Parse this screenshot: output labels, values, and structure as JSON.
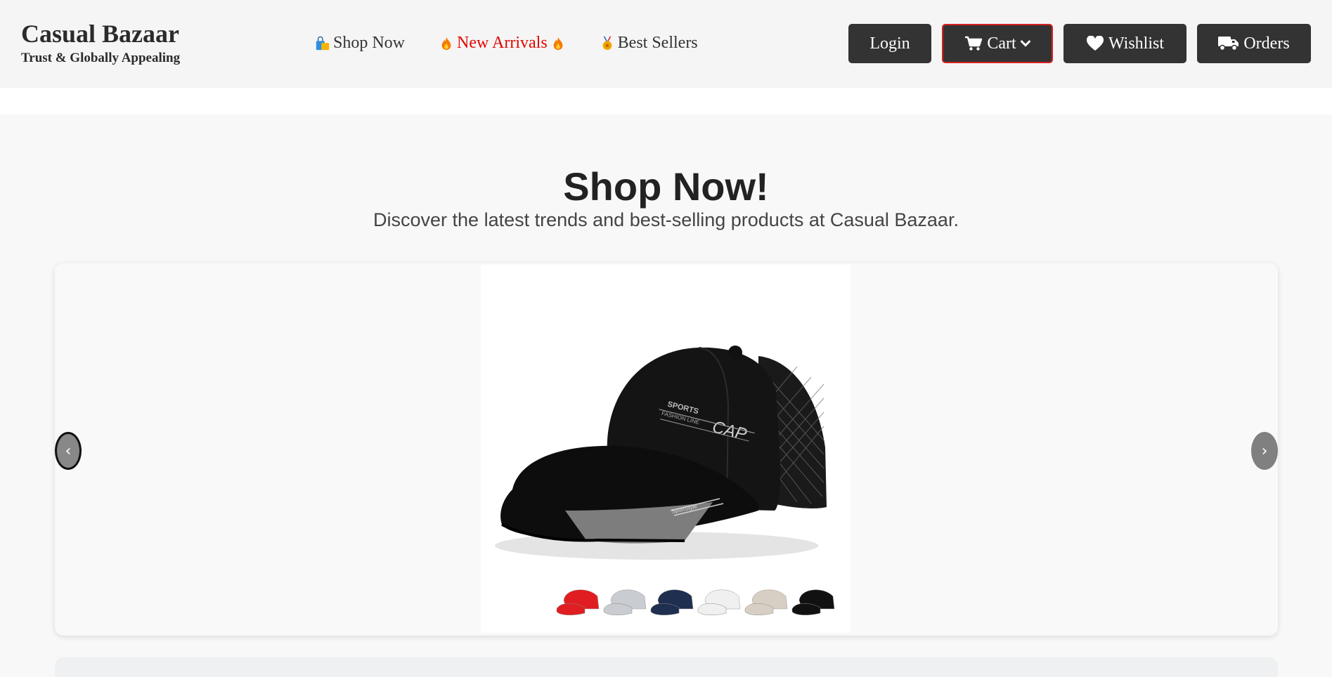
{
  "brand": {
    "name": "Casual Bazaar",
    "tagline": "Trust & Globally Appealing"
  },
  "nav": [
    {
      "label": "Shop Now",
      "icon": "shopping-bags-icon"
    },
    {
      "label": "New Arrivals",
      "icon": "fire-icon",
      "color": "#e10600"
    },
    {
      "label": "Best Sellers",
      "icon": "medal-icon"
    }
  ],
  "actions": {
    "login": "Login",
    "cart": "Cart",
    "wishlist": "Wishlist",
    "orders": "Orders"
  },
  "hero": {
    "title": "Shop Now!",
    "subtitle": "Discover the latest trends and best-selling products at Casual Bazaar."
  },
  "carousel": {
    "prev": "‹",
    "next": "›",
    "slide_alt": "Black sports baseball cap with mesh back",
    "cap_text": {
      "line1": "SPORTS",
      "line2": "FASHION LINE",
      "line3": "CAP",
      "brim": "SportStyle"
    },
    "swatches": [
      "#e01d20",
      "#c9ccd0",
      "#1f2f4f",
      "#f0f0f0",
      "#d8cfc4",
      "#111111"
    ]
  },
  "colors": {
    "accent": "#e10600",
    "button": "#333333",
    "cart_border": "#d82020"
  }
}
